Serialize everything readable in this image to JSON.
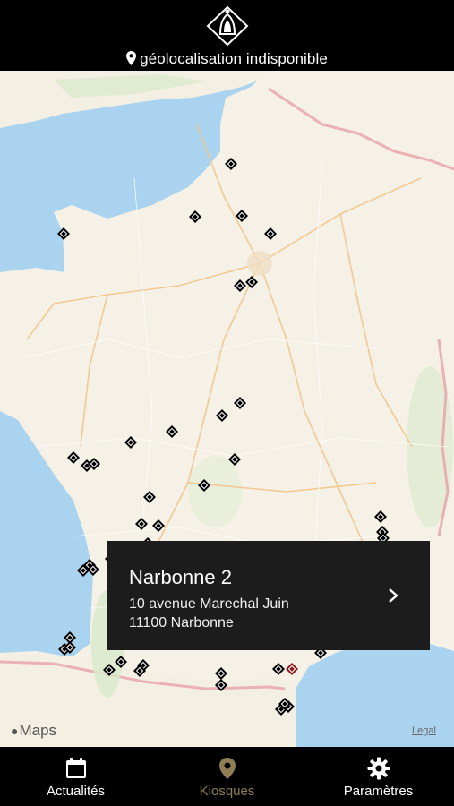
{
  "header": {
    "logo_icon": "hooded-figure-logo",
    "geolocation_text": "géolocalisation indisponible"
  },
  "map": {
    "attribution_label": "Maps",
    "legal_label": "Legal",
    "colors": {
      "land": "#f5f1e6",
      "water": "#a9d3ef",
      "marker": "#000000",
      "selected_marker": "#8b1a1a"
    }
  },
  "popup": {
    "title": "Narbonne 2",
    "address_line1": "10 avenue Marechal Juin",
    "address_line2": "11100 Narbonne",
    "chevron_icon": "chevron-right-icon"
  },
  "tabs": [
    {
      "label": "Actualités",
      "icon": "calendar-icon",
      "active": false
    },
    {
      "label": "Kiosques",
      "icon": "map-pin-icon",
      "active": true
    },
    {
      "label": "Paramètres",
      "icon": "gear-icon",
      "active": false
    }
  ],
  "accent_color": "#8f7e54"
}
